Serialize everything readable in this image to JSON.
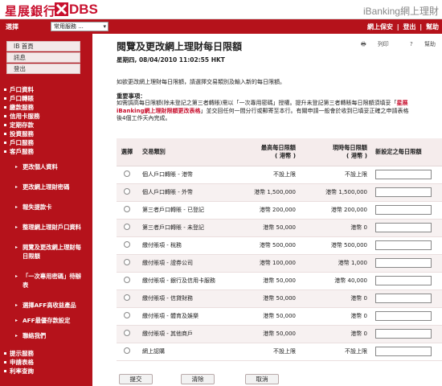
{
  "header": {
    "logo_zh": "星展銀行",
    "logo_en": "DBS",
    "app_title": "iBanking網上理財"
  },
  "topbar": {
    "select_label": "選擇",
    "select_value": "常用服務 ...",
    "right_items": [
      "網上保安",
      "|",
      "登出",
      "|",
      "幫助"
    ]
  },
  "sidebar": {
    "quick": [
      "IB 首頁",
      "訊息",
      "登出"
    ],
    "nav_top": [
      "戶口資料",
      "戶口轉賬",
      "繳款服務",
      "信用卡服務",
      "定期存款",
      "投資服務",
      "戶口服務",
      "客戶服務"
    ],
    "sub": [
      [
        "更改個人資料"
      ],
      [
        "更改網上理財密碼"
      ],
      [
        "報失提款卡"
      ],
      [
        "整理網上理財戶口資料"
      ],
      [
        "閱覽及更改網上理財每",
        "日限額"
      ],
      [
        "「一次專用密碼」待辦",
        "表"
      ],
      [
        "選擇AFF高收益產品"
      ],
      [
        "AFF最優存款設定"
      ],
      [
        "聯絡我們"
      ]
    ],
    "nav_bottom": [
      "提示服務",
      "申請表格",
      "利率查詢"
    ]
  },
  "page": {
    "title": "閱覽及更改網上理財每日限額",
    "print": "列印",
    "help": "幫助",
    "datetime": "星期四, 08/04/2010 11:02:55 HKT",
    "intro": "如欲更改網上理財每日限額，請選擇交易類別及輸入新的每日限額。",
    "important_heading": "重要事項：",
    "important_line1_a": "如需調高每日限額(除未登記之第三者轉賬)需以「一次專用密碼」授權。提升未登記第三者轉賬每日限額須填妥「",
    "important_line1_red": "星展",
    "important_line2_red": "iBanking網上理財限額更改表格",
    "important_line2_b": "」並交回任何一間分行或郵寄至本行。有關申請一般會於收到已填妥正確之申請表格",
    "important_line3": "後4個工作天內完成。"
  },
  "table": {
    "headers": {
      "select": "選擇",
      "type": "交易類別",
      "max_limit": "最高每日限額",
      "max_unit": "( 港幣 )",
      "current": "現時每日限額",
      "current_unit": "( 港幣 )",
      "new": "新設定之每日限額"
    },
    "rows": [
      {
        "type": "個人戶口轉賬 - 港幣",
        "max": "不設上限",
        "current": "不設上限"
      },
      {
        "type": "個人戶口轉賬 - 外幣",
        "max": "港幣 1,500,000",
        "current": "港幣 1,500,000"
      },
      {
        "type": "第三者戶口轉賬 - 已登記",
        "max": "港幣 200,000",
        "current": "港幣 200,000"
      },
      {
        "type": "第三者戶口轉賬 - 未登記",
        "max": "港幣 50,000",
        "current": "港幣 0"
      },
      {
        "type": "繳付賬項 - 稅務",
        "max": "港幣 500,000",
        "current": "港幣 500,000"
      },
      {
        "type": "繳付賬項 - 證券公司",
        "max": "港幣 100,000",
        "current": "港幣 1,000"
      },
      {
        "type": "繳付賬項 - 銀行及信用卡服務",
        "max": "港幣 50,000",
        "current": "港幣 40,000"
      },
      {
        "type": "繳付賬項 - 信貸財務",
        "max": "港幣 50,000",
        "current": "港幣 0"
      },
      {
        "type": "繳付賬項 - 體育及娛樂",
        "max": "港幣 50,000",
        "current": "港幣 0"
      },
      {
        "type": "繳付賬項 - 其他商戶",
        "max": "港幣 50,000",
        "current": "港幣 0"
      },
      {
        "type": "網上認購",
        "max": "不設上限",
        "current": "不設上限"
      }
    ]
  },
  "buttons": {
    "submit": "提交",
    "clear": "清除",
    "cancel": "取消"
  },
  "colors": {
    "brand_red": "#b5121b",
    "logo_red": "#c8102e"
  }
}
